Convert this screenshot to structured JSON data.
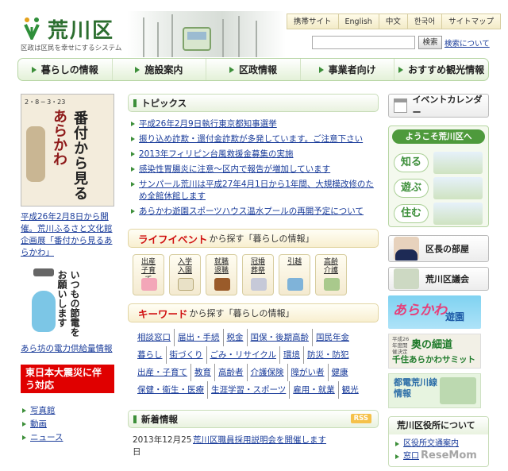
{
  "header": {
    "logo_name": "荒川区",
    "logo_tagline": "区政は区民を幸せにするシステム",
    "top_links": [
      "携帯サイト",
      "English",
      "中文",
      "한국어",
      "サイトマップ"
    ],
    "search_button": "検索",
    "search_help": "検索について"
  },
  "nav": [
    "暮らしの情報",
    "施設案内",
    "区政情報",
    "事業者向け",
    "おすすめ観光情報"
  ],
  "left": {
    "poster_title_a": "番付から見る",
    "poster_title_b": "あらかわ",
    "poster_dates": "2・8 ─ 3・23",
    "poster_link": "平成26年2月8日から開催。荒川ふるさと文化館企画展「番付から見るあらかわ」",
    "setsuden_text": "いつもの節電をお願いします",
    "setsuden_link": "あら坊の電力供給量情報",
    "quake": "東日本大震災に伴う対応",
    "list": [
      "写真館",
      "動画",
      "ニュース"
    ]
  },
  "topics": {
    "heading": "トピックス",
    "items": [
      "平成26年2月9日執行東京都知事選挙",
      "振り込め詐欺・還付金詐欺が多発しています。ご注意下さい",
      "2013年フィリピン台風救援金募集の実施",
      "感染性胃腸炎に注意～区内で報告が増加しています",
      "サンパール荒川は平成27年4月1日から1年間、大規模改修のため全館休館します",
      "あらかわ遊園スポーツハウス温水プールの再開予定について"
    ]
  },
  "life_event": {
    "em": "ライフイベント",
    "rest": "から探す「暮らしの情報」",
    "items": [
      "出産子育て",
      "入学入園",
      "就職退職",
      "冠婚葬祭",
      "引越",
      "高齢介護"
    ]
  },
  "keyword": {
    "em": "キーワード",
    "rest": "から探す「暮らしの情報」",
    "rows": [
      [
        "相談窓口",
        "届出・手続",
        "税金",
        "国保・後期高齢",
        "国民年金"
      ],
      [
        "暮らし",
        "街づくり",
        "ごみ・リサイクル",
        "環境",
        "防災・防犯"
      ],
      [
        "出産・子育て",
        "教育",
        "高齢者",
        "介護保険",
        "障がい者",
        "健康"
      ],
      [
        "保健・衛生・医療",
        "生涯学習・スポーツ",
        "雇用・就業",
        "観光"
      ]
    ]
  },
  "news": {
    "heading": "新着情報",
    "rss": "RSS",
    "date": "2013年12月25日",
    "title": "荒川区職員採用説明会を開催します"
  },
  "right": {
    "calendar": "イベントカレンダー",
    "welcome": "ようこそ荒川区へ",
    "welcome_items": [
      "知る",
      "遊ぶ",
      "住む"
    ],
    "mayor": "区長の部屋",
    "gikai": "荒川区議会",
    "yuen_a": "あらかわ",
    "yuen_b": "遊園",
    "okuno_a": "平成26年度開催決定",
    "okuno_b": "奥の細道",
    "okuno_c": "千住あらかわサミット",
    "toden": "都電荒川線情報",
    "office_heading": "荒川区役所について",
    "office_items": [
      "区役所交通案内",
      "窓口"
    ]
  },
  "watermark": "ReseMom"
}
